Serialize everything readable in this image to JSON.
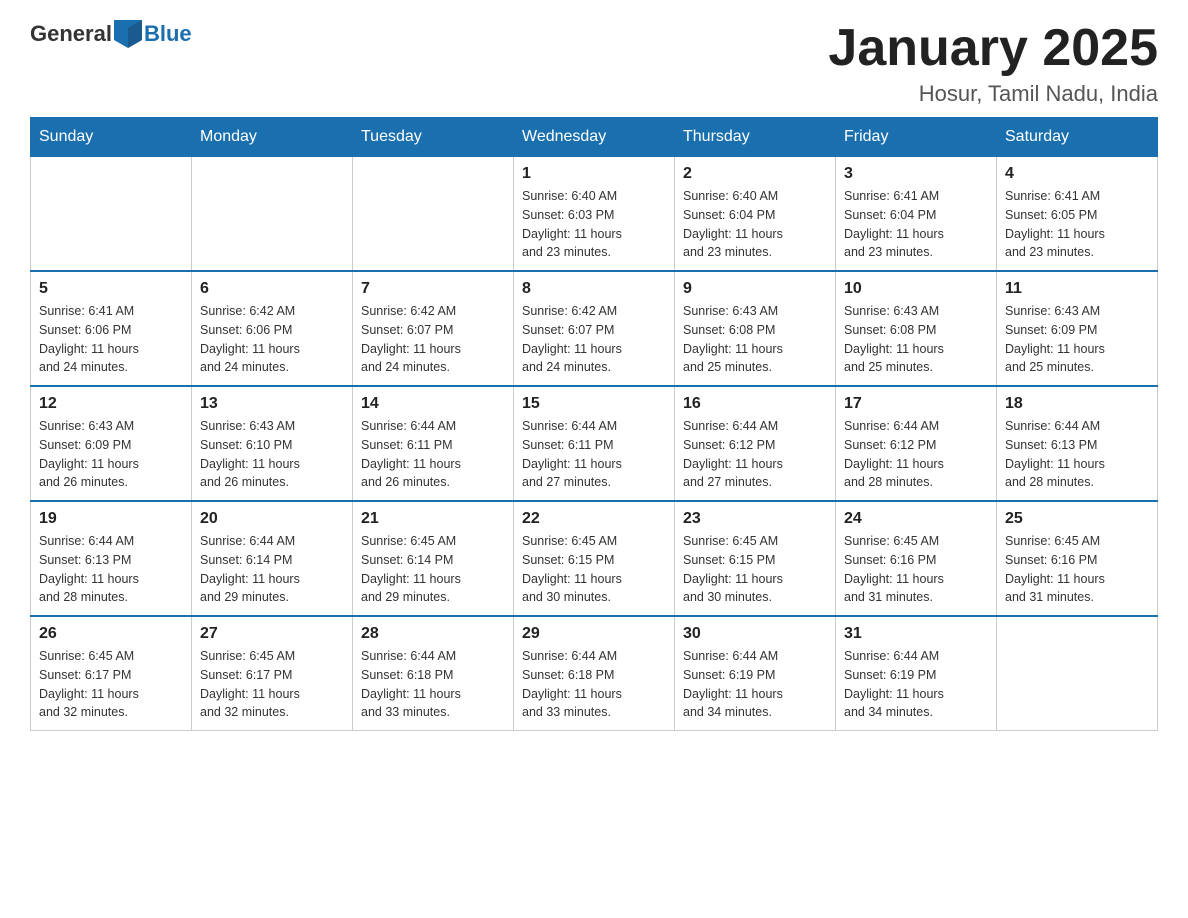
{
  "header": {
    "logo_general": "General",
    "logo_blue": "Blue",
    "month_title": "January 2025",
    "location": "Hosur, Tamil Nadu, India"
  },
  "days_of_week": [
    "Sunday",
    "Monday",
    "Tuesday",
    "Wednesday",
    "Thursday",
    "Friday",
    "Saturday"
  ],
  "weeks": [
    {
      "days": [
        {
          "num": "",
          "info": ""
        },
        {
          "num": "",
          "info": ""
        },
        {
          "num": "",
          "info": ""
        },
        {
          "num": "1",
          "info": "Sunrise: 6:40 AM\nSunset: 6:03 PM\nDaylight: 11 hours\nand 23 minutes."
        },
        {
          "num": "2",
          "info": "Sunrise: 6:40 AM\nSunset: 6:04 PM\nDaylight: 11 hours\nand 23 minutes."
        },
        {
          "num": "3",
          "info": "Sunrise: 6:41 AM\nSunset: 6:04 PM\nDaylight: 11 hours\nand 23 minutes."
        },
        {
          "num": "4",
          "info": "Sunrise: 6:41 AM\nSunset: 6:05 PM\nDaylight: 11 hours\nand 23 minutes."
        }
      ]
    },
    {
      "days": [
        {
          "num": "5",
          "info": "Sunrise: 6:41 AM\nSunset: 6:06 PM\nDaylight: 11 hours\nand 24 minutes."
        },
        {
          "num": "6",
          "info": "Sunrise: 6:42 AM\nSunset: 6:06 PM\nDaylight: 11 hours\nand 24 minutes."
        },
        {
          "num": "7",
          "info": "Sunrise: 6:42 AM\nSunset: 6:07 PM\nDaylight: 11 hours\nand 24 minutes."
        },
        {
          "num": "8",
          "info": "Sunrise: 6:42 AM\nSunset: 6:07 PM\nDaylight: 11 hours\nand 24 minutes."
        },
        {
          "num": "9",
          "info": "Sunrise: 6:43 AM\nSunset: 6:08 PM\nDaylight: 11 hours\nand 25 minutes."
        },
        {
          "num": "10",
          "info": "Sunrise: 6:43 AM\nSunset: 6:08 PM\nDaylight: 11 hours\nand 25 minutes."
        },
        {
          "num": "11",
          "info": "Sunrise: 6:43 AM\nSunset: 6:09 PM\nDaylight: 11 hours\nand 25 minutes."
        }
      ]
    },
    {
      "days": [
        {
          "num": "12",
          "info": "Sunrise: 6:43 AM\nSunset: 6:09 PM\nDaylight: 11 hours\nand 26 minutes."
        },
        {
          "num": "13",
          "info": "Sunrise: 6:43 AM\nSunset: 6:10 PM\nDaylight: 11 hours\nand 26 minutes."
        },
        {
          "num": "14",
          "info": "Sunrise: 6:44 AM\nSunset: 6:11 PM\nDaylight: 11 hours\nand 26 minutes."
        },
        {
          "num": "15",
          "info": "Sunrise: 6:44 AM\nSunset: 6:11 PM\nDaylight: 11 hours\nand 27 minutes."
        },
        {
          "num": "16",
          "info": "Sunrise: 6:44 AM\nSunset: 6:12 PM\nDaylight: 11 hours\nand 27 minutes."
        },
        {
          "num": "17",
          "info": "Sunrise: 6:44 AM\nSunset: 6:12 PM\nDaylight: 11 hours\nand 28 minutes."
        },
        {
          "num": "18",
          "info": "Sunrise: 6:44 AM\nSunset: 6:13 PM\nDaylight: 11 hours\nand 28 minutes."
        }
      ]
    },
    {
      "days": [
        {
          "num": "19",
          "info": "Sunrise: 6:44 AM\nSunset: 6:13 PM\nDaylight: 11 hours\nand 28 minutes."
        },
        {
          "num": "20",
          "info": "Sunrise: 6:44 AM\nSunset: 6:14 PM\nDaylight: 11 hours\nand 29 minutes."
        },
        {
          "num": "21",
          "info": "Sunrise: 6:45 AM\nSunset: 6:14 PM\nDaylight: 11 hours\nand 29 minutes."
        },
        {
          "num": "22",
          "info": "Sunrise: 6:45 AM\nSunset: 6:15 PM\nDaylight: 11 hours\nand 30 minutes."
        },
        {
          "num": "23",
          "info": "Sunrise: 6:45 AM\nSunset: 6:15 PM\nDaylight: 11 hours\nand 30 minutes."
        },
        {
          "num": "24",
          "info": "Sunrise: 6:45 AM\nSunset: 6:16 PM\nDaylight: 11 hours\nand 31 minutes."
        },
        {
          "num": "25",
          "info": "Sunrise: 6:45 AM\nSunset: 6:16 PM\nDaylight: 11 hours\nand 31 minutes."
        }
      ]
    },
    {
      "days": [
        {
          "num": "26",
          "info": "Sunrise: 6:45 AM\nSunset: 6:17 PM\nDaylight: 11 hours\nand 32 minutes."
        },
        {
          "num": "27",
          "info": "Sunrise: 6:45 AM\nSunset: 6:17 PM\nDaylight: 11 hours\nand 32 minutes."
        },
        {
          "num": "28",
          "info": "Sunrise: 6:44 AM\nSunset: 6:18 PM\nDaylight: 11 hours\nand 33 minutes."
        },
        {
          "num": "29",
          "info": "Sunrise: 6:44 AM\nSunset: 6:18 PM\nDaylight: 11 hours\nand 33 minutes."
        },
        {
          "num": "30",
          "info": "Sunrise: 6:44 AM\nSunset: 6:19 PM\nDaylight: 11 hours\nand 34 minutes."
        },
        {
          "num": "31",
          "info": "Sunrise: 6:44 AM\nSunset: 6:19 PM\nDaylight: 11 hours\nand 34 minutes."
        },
        {
          "num": "",
          "info": ""
        }
      ]
    }
  ]
}
